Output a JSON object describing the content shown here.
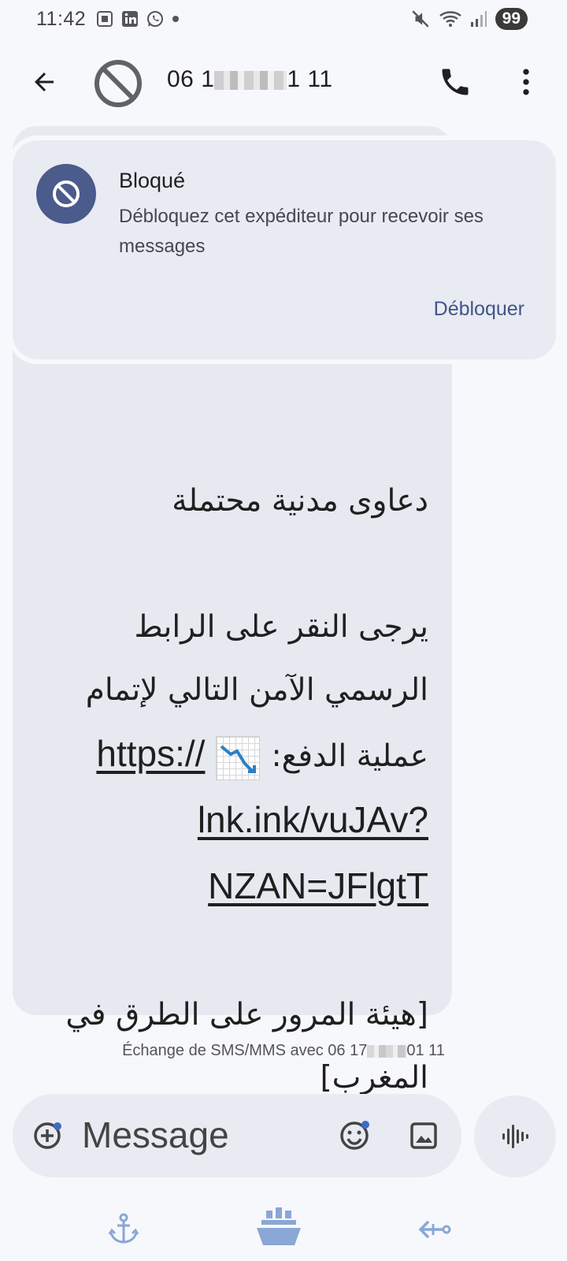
{
  "status_bar": {
    "time": "11:42",
    "left_icons": [
      "screenshot-icon",
      "linkedin-icon",
      "whatsapp-icon",
      "dot-icon"
    ],
    "right_icons": [
      "mute-icon",
      "wifi-icon",
      "signal-icon"
    ],
    "battery": "99"
  },
  "app_bar": {
    "contact_prefix": "06 1",
    "contact_suffix": "1 11"
  },
  "blocked_card": {
    "title": "Bloqué",
    "description": "Débloquez cet expéditeur pour recevoir ses messages",
    "unblock_label": "Débloquer"
  },
  "message": {
    "line1": "دعاوى مدنية محتملة",
    "line2": "يرجى النقر على الرابط",
    "line3": "الرسمي الآمن التالي لإتمام",
    "line4_text": "عملية الدفع:",
    "link_part1": "https://",
    "link_part2": "lnk.ink/vuJAv?",
    "link_part3": "NZAN=JFlgtT",
    "line5": "[هيئة المرور على الطرق في",
    "line6": "المغرب]"
  },
  "footer": {
    "exchange_prefix": "Échange de SMS/MMS avec 06 17",
    "exchange_suffix": "01 11"
  },
  "compose": {
    "placeholder": "Message"
  },
  "colors": {
    "background": "#f7f8fc",
    "bubble": "#e7e9f0",
    "accent": "#41558a",
    "blocked_icon_bg": "#4a5b8c"
  }
}
